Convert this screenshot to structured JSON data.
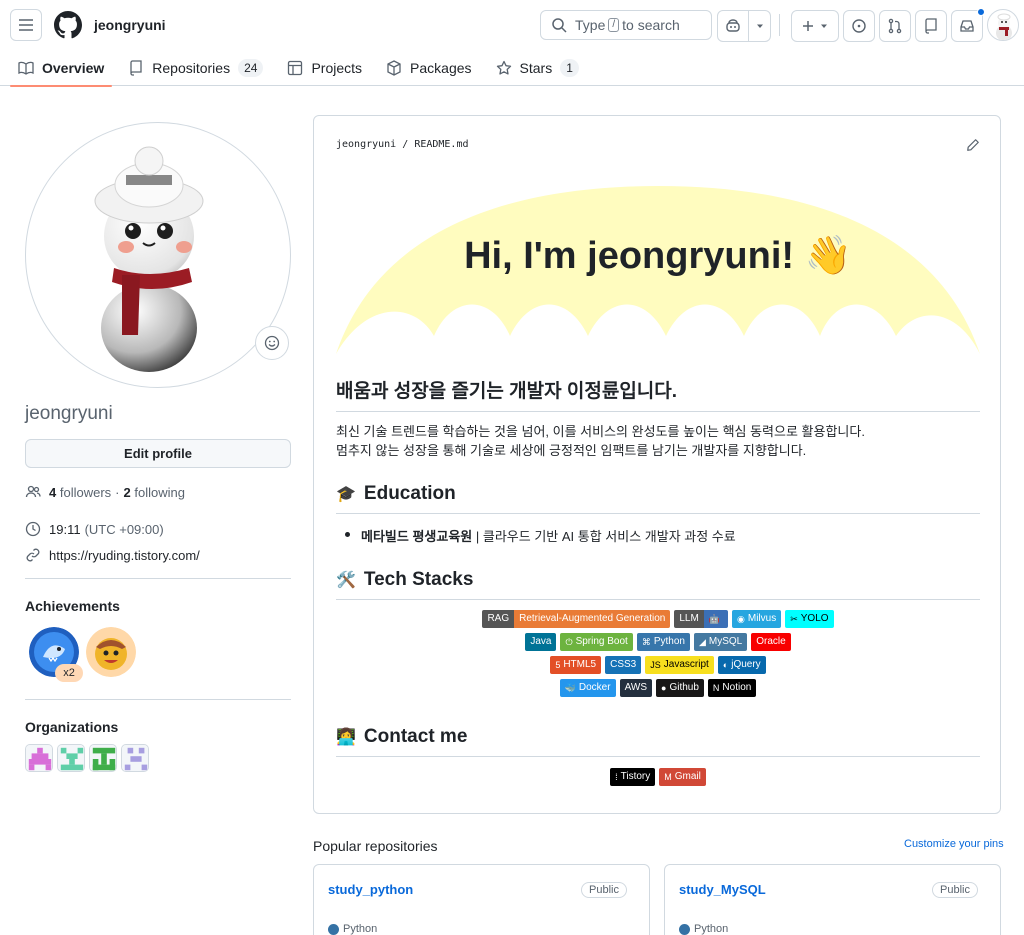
{
  "header": {
    "username": "jeongryuni",
    "search_pre": "Type",
    "search_key": "/",
    "search_post": "to search"
  },
  "tabs": [
    {
      "label": "Overview",
      "icon": "book-icon",
      "active": true
    },
    {
      "label": "Repositories",
      "icon": "repo-icon",
      "count": "24"
    },
    {
      "label": "Projects",
      "icon": "table-icon"
    },
    {
      "label": "Packages",
      "icon": "package-icon"
    },
    {
      "label": "Stars",
      "icon": "star-icon",
      "count": "1"
    }
  ],
  "sidebar": {
    "login": "jeongryuni",
    "edit_profile": "Edit profile",
    "followers_count": "4",
    "followers_label": "followers",
    "separator": "·",
    "following_count": "2",
    "following_label": "following",
    "time": "19:11",
    "timezone": "(UTC +09:00)",
    "url": "https://ryuding.tistory.com/",
    "achievements_title": "Achievements",
    "achievement_multiplier": "x2",
    "organizations_title": "Organizations"
  },
  "readme": {
    "path_user": "jeongryuni",
    "path_sep": "/",
    "path_file": "README.md",
    "greeting": "Hi, I'm jeongryuni! 👋",
    "h1": "배움과 성장을 즐기는 개발자 이정륜입니다.",
    "p_line1": "최신 기술 트렌드를 학습하는 것을 넘어, 이를 서비스의 완성도를 높이는 핵심 동력으로 활용합니다.",
    "p_line2": "멈추지 않는 성장을 통해 기술로 세상에 긍정적인 임팩트를 남기는 개발자를 지향합니다.",
    "education_icon": "🎓",
    "education_title": "Education",
    "edu_strong": "메타빌드 평생교육원",
    "edu_rest": " | 클라우드 기반 AI 통합 서비스 개발자 과정 수료",
    "tech_icon": "🛠️",
    "tech_title": "Tech Stacks",
    "contact_icon": "👩‍💻",
    "contact_title": "Contact me"
  },
  "badges": {
    "row1": [
      {
        "left": "RAG",
        "right": "Retrieval-Augmented Generation",
        "lc": "#555555",
        "rc": "#e97b36"
      },
      {
        "left": "LLM",
        "right": "",
        "lc": "#555555",
        "rc": "#3b6fb6",
        "glyph": "🤖"
      },
      {
        "right": "Milvus",
        "rc": "#26a6e0",
        "glyph": "◉"
      },
      {
        "right": "YOLO",
        "rc": "#00ffff",
        "glyph": "✂",
        "dark": true
      }
    ],
    "row2": [
      {
        "right": "Java",
        "rc": "#007396"
      },
      {
        "right": "Spring Boot",
        "rc": "#6db33f",
        "glyph": "⏻"
      },
      {
        "right": "Python",
        "rc": "#3776ab",
        "glyph": "⌘"
      },
      {
        "right": "MySQL",
        "rc": "#4479a1",
        "glyph": "◢"
      },
      {
        "right": "Oracle",
        "rc": "#f80000"
      }
    ],
    "row3": [
      {
        "right": "HTML5",
        "rc": "#e34f26",
        "glyph": "5"
      },
      {
        "right": "CSS3",
        "rc": "#1572b6"
      },
      {
        "right": "Javascript",
        "rc": "#f7df1e",
        "glyph": "JS",
        "dark": true
      },
      {
        "right": "jQuery",
        "rc": "#0769ad",
        "glyph": "◐"
      }
    ],
    "row4": [
      {
        "right": "Docker",
        "rc": "#2496ed",
        "glyph": "🐳"
      },
      {
        "right": "AWS",
        "rc": "#232f3e"
      },
      {
        "right": "Github",
        "rc": "#181717",
        "glyph": "●"
      },
      {
        "right": "Notion",
        "rc": "#000000",
        "glyph": "N"
      }
    ],
    "contact": [
      {
        "right": "Tistory",
        "rc": "#000000",
        "glyph": "⁞"
      },
      {
        "right": "Gmail",
        "rc": "#d14836",
        "glyph": "M"
      }
    ]
  },
  "popular": {
    "title": "Popular repositories",
    "customize": "Customize your pins",
    "repos": [
      {
        "name": "study_python",
        "visibility": "Public",
        "language": "Python",
        "lang_color": "#3572A5"
      },
      {
        "name": "study_MySQL",
        "visibility": "Public",
        "language": "Python",
        "lang_color": "#3572A5"
      }
    ]
  }
}
